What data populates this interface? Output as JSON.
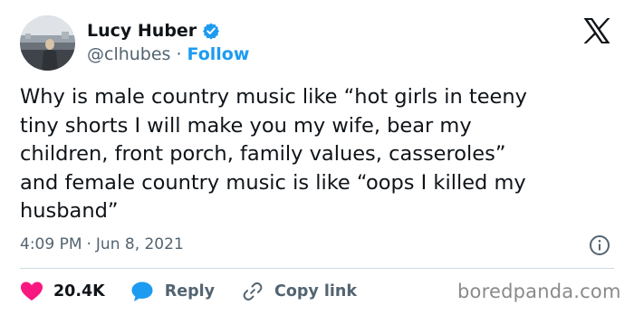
{
  "author": {
    "display_name": "Lucy Huber",
    "handle": "@clhubes",
    "separator": "·",
    "follow_label": "Follow"
  },
  "tweet": {
    "text": "Why is male country music like “hot girls in teeny\ntiny shorts I will make you my wife, bear my\nchildren, front porch, family values, casseroles”\nand female country music is like “oops I killed my\nhusband”",
    "time": "4:09 PM",
    "meta_separator": "·",
    "date": "Jun 8, 2021"
  },
  "actions": {
    "like_count": "20.4K",
    "reply_label": "Reply",
    "copy_link_label": "Copy link"
  },
  "watermark": "boredpanda.com",
  "colors": {
    "accent": "#1d9bf0",
    "like": "#f91880",
    "text_primary": "#0f1419",
    "text_secondary": "#536471",
    "divider": "#cfd9de"
  },
  "icons": {
    "verified": "verified-badge-icon",
    "platform": "x-logo-icon",
    "info": "info-icon",
    "like": "heart-icon",
    "reply": "speech-bubble-icon",
    "copy": "link-icon"
  }
}
